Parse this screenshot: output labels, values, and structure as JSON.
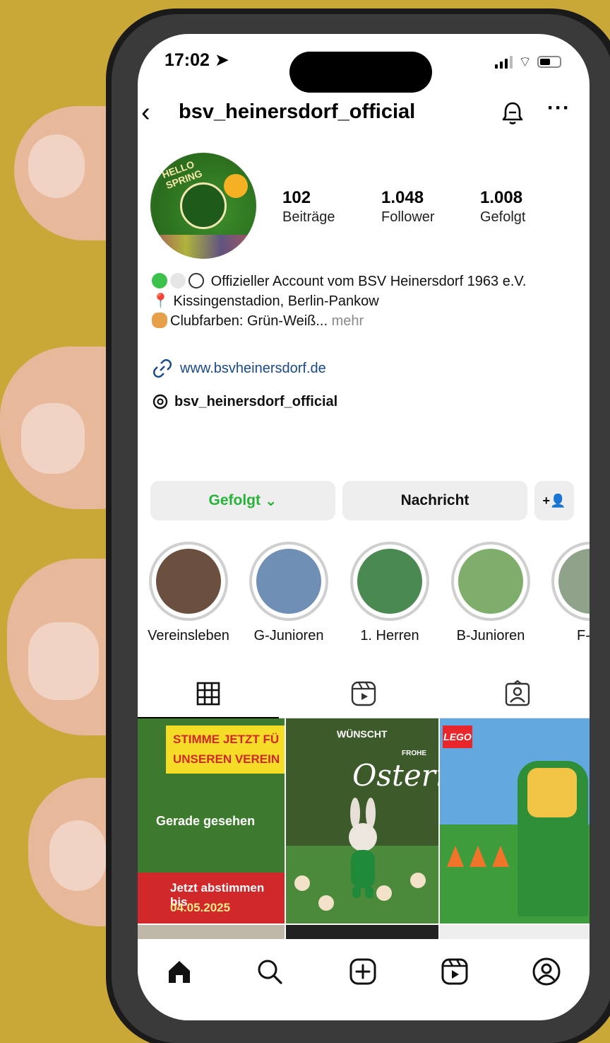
{
  "status_bar": {
    "time": "17:02"
  },
  "header": {
    "username": "bsv_heinersdorf_official"
  },
  "avatar": {
    "line1": "HELLO",
    "line2": "SPRING"
  },
  "stats": [
    {
      "value": "102",
      "label": "Beiträge"
    },
    {
      "value": "1.048",
      "label": "Follower"
    },
    {
      "value": "1.008",
      "label": "Gefolgt"
    }
  ],
  "bio": {
    "line1": "Offizieller Account vom BSV Heinersdorf 1963 e.V.",
    "line2": "Kissingenstadion, Berlin-Pankow",
    "line3": "Clubfarben: Grün-Weiß...",
    "more": "mehr",
    "link": "www.bsvheinersdorf.de",
    "threads": "bsv_heinersdorf_official"
  },
  "buttons": {
    "follow": "Gefolgt",
    "message": "Nachricht"
  },
  "stories": [
    {
      "label": "Vereinsleben",
      "color": "#6b4f3f"
    },
    {
      "label": "G-Junioren",
      "color": "#6f8fb5"
    },
    {
      "label": "1. Herren",
      "color": "#4a8a52"
    },
    {
      "label": "B-Junioren",
      "color": "#7fae6c"
    },
    {
      "label": "F-Ju",
      "color": "#8fa38a"
    }
  ],
  "posts": {
    "p1": {
      "banner1": "STIMME JETZT FÜ",
      "banner2": "UNSEREN VEREIN",
      "overlay": "Gerade gesehen",
      "vote1": "Jetzt abstimmen bis",
      "vote2": "04.05.2025"
    },
    "p2": {
      "top": "WÜNSCHT",
      "frohe": "FROHE",
      "script": "Ostern"
    },
    "p3": {
      "brand": "LEGO"
    }
  },
  "colors": {
    "follow_green": "#27b23a",
    "link_blue": "#1a4a8a"
  }
}
